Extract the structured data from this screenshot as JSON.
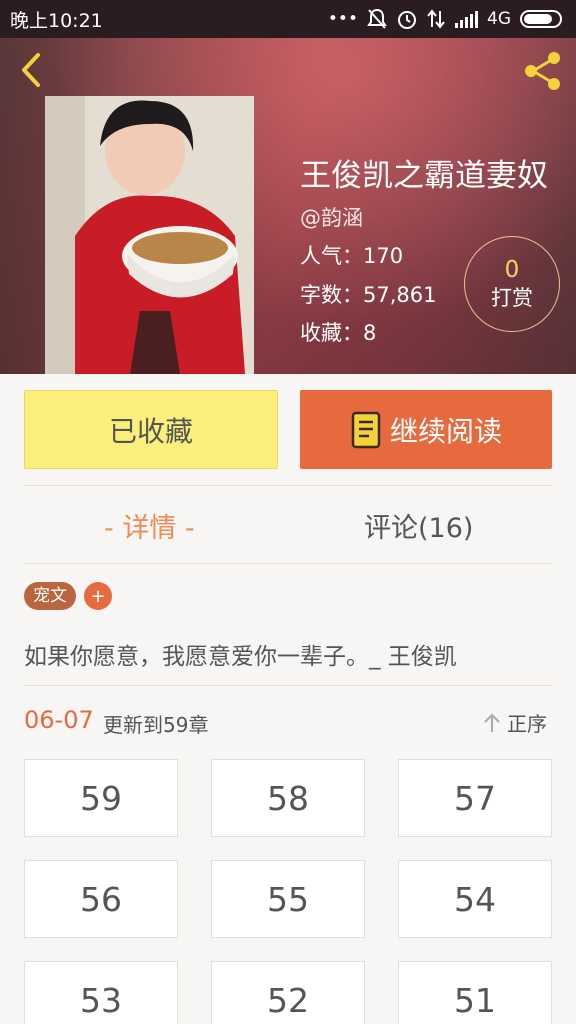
{
  "status_bar": {
    "time": "晚上10:21",
    "network": "4G",
    "icons": [
      "dots-icon",
      "mute-icon",
      "alarm-icon",
      "data-transfer-icon",
      "signal-icon",
      "battery-icon"
    ]
  },
  "book": {
    "title": "王俊凯之霸道妻奴",
    "author": "@韵涵",
    "popularity": "人气：170",
    "word_count": "字数：57,861",
    "favorites": "收藏：8"
  },
  "tip": {
    "count": "0",
    "label": "打赏"
  },
  "actions": {
    "favorite_label": "已收藏",
    "read_label": "继续阅读"
  },
  "tabs": {
    "detail": "- 详情 -",
    "comments": "评论(16)"
  },
  "tags": [
    "宠文"
  ],
  "tag_add": "+",
  "summary": "如果你愿意，我愿意爱你一辈子。_ 王俊凯",
  "update": {
    "date": "06-07",
    "text": "更新到59章",
    "sort_label": "正序"
  },
  "chapters": [
    "59",
    "58",
    "57",
    "56",
    "55",
    "54",
    "53",
    "52",
    "51"
  ],
  "colors": {
    "accent": "#e66a3e",
    "favorite_button": "#f9ef7a",
    "tip_count": "#f5d36b",
    "tab_active": "#ef8a55"
  }
}
